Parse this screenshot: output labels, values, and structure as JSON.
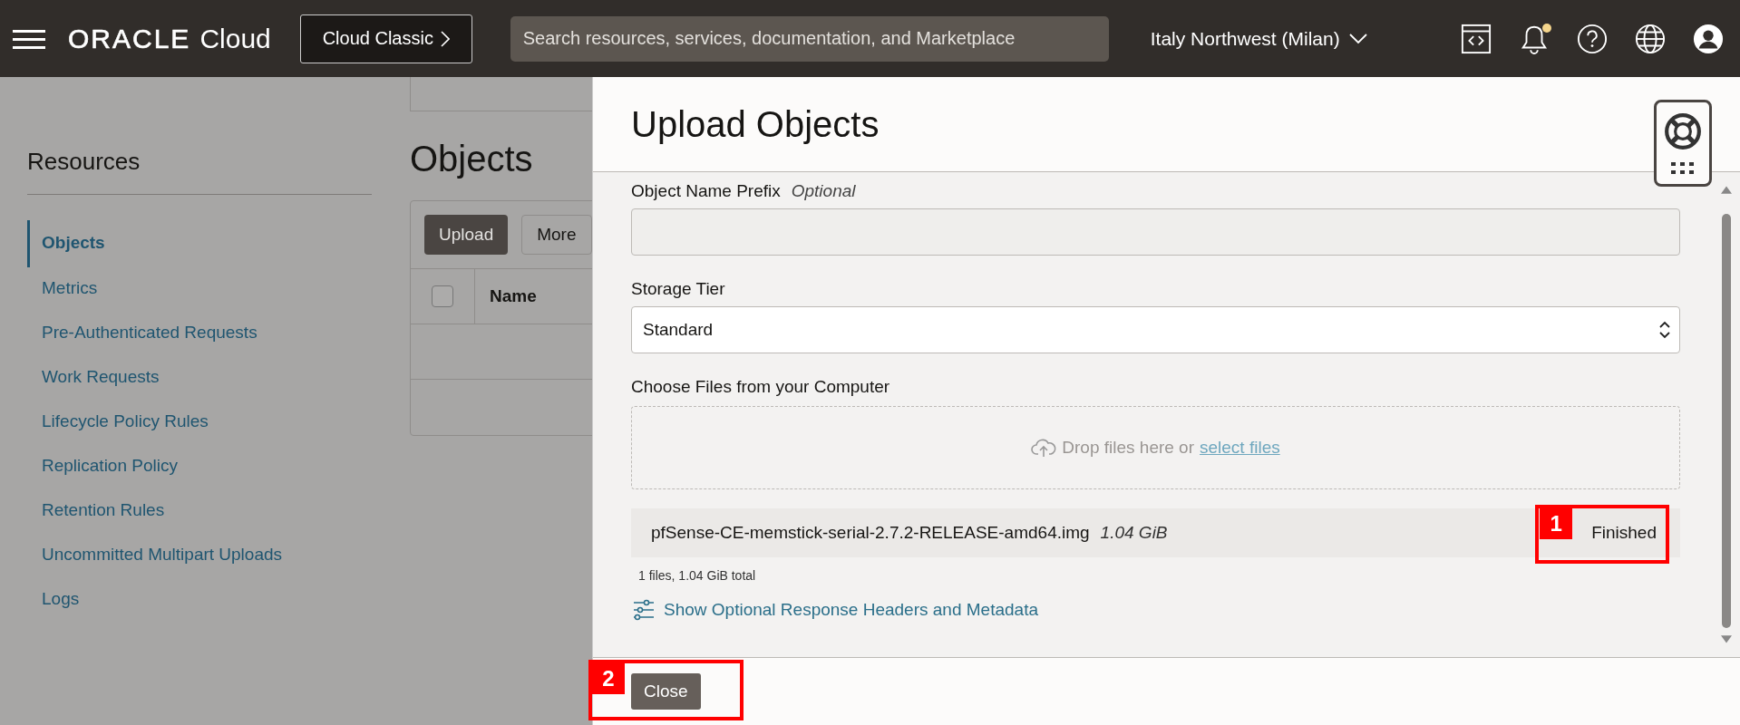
{
  "top_bar": {
    "brand": "ORACLE",
    "product": "Cloud",
    "classic_button": "Cloud Classic",
    "search": {
      "placeholder": "Search resources, services, documentation, and Marketplace"
    },
    "region": "Italy Northwest (Milan)",
    "notification_unread": true
  },
  "resources": {
    "title": "Resources",
    "items": [
      {
        "label": "Objects",
        "selected": true
      },
      {
        "label": "Metrics",
        "selected": false
      },
      {
        "label": "Pre-Authenticated Requests",
        "selected": false
      },
      {
        "label": "Work Requests",
        "selected": false
      },
      {
        "label": "Lifecycle Policy Rules",
        "selected": false
      },
      {
        "label": "Replication Policy",
        "selected": false
      },
      {
        "label": "Retention Rules",
        "selected": false
      },
      {
        "label": "Uncommitted Multipart Uploads",
        "selected": false
      },
      {
        "label": "Logs",
        "selected": false
      }
    ]
  },
  "objects": {
    "title": "Objects",
    "buttons": [
      {
        "label": "Upload",
        "kind": "primary"
      },
      {
        "label": "More",
        "kind": "secondary"
      }
    ],
    "columns": [
      "Name"
    ],
    "select_all_checked": false
  },
  "drawer": {
    "title": "Upload Objects",
    "prefix": {
      "label": "Object Name Prefix",
      "hint": "Optional"
    },
    "storage_tier": {
      "label": "Storage Tier",
      "value": "Standard"
    },
    "files": {
      "label": "Choose Files from your Computer",
      "drop_text": "Drop files here or",
      "select_link": "select files",
      "items": [
        {
          "name": "pfSense-CE-memstick-serial-2.7.2-RELEASE-amd64.img",
          "size": "1.04 GiB",
          "status": "Finished",
          "annotation": "1"
        }
      ],
      "summary": "1 files, 1.04 GiB total"
    },
    "options_link": "Show Optional Response Headers and Metadata",
    "close_button": {
      "label": "Close",
      "annotation": "2"
    }
  }
}
